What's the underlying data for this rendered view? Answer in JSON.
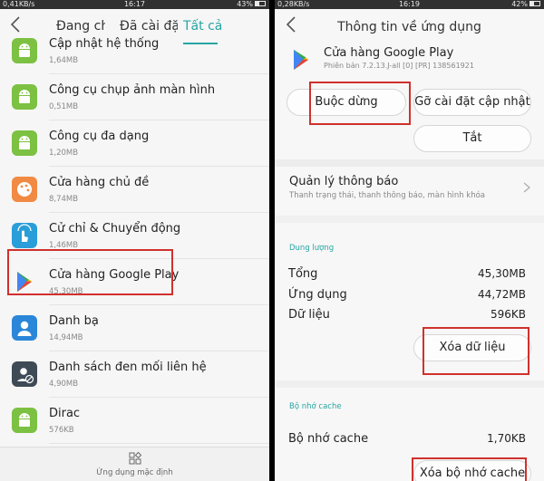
{
  "left": {
    "status": {
      "left": "0,41KB/s",
      "time": "16:17",
      "battery": "43%",
      "battery_level": 0.43
    },
    "tabs": [
      {
        "label": "Đang chạy",
        "active": false
      },
      {
        "label": "Đã cài đặt",
        "active": false
      },
      {
        "label": "Tất cả",
        "active": true
      }
    ],
    "apps": [
      {
        "name": "Cập nhật hệ thống",
        "size": "1,64MB",
        "icon": "android-icon",
        "color": "#7cc142"
      },
      {
        "name": "Công cụ chụp ảnh màn hình",
        "size": "0,51MB",
        "icon": "android-icon",
        "color": "#7cc142"
      },
      {
        "name": "Công cụ đa dạng",
        "size": "1,20MB",
        "icon": "android-icon",
        "color": "#7cc142"
      },
      {
        "name": "Cửa hàng chủ đề",
        "size": "8,74MB",
        "icon": "palette-icon",
        "color": "#f18a43"
      },
      {
        "name": "Cử chỉ & Chuyển động",
        "size": "1,46MB",
        "icon": "gesture-icon",
        "color": "#2a9ed8"
      },
      {
        "name": "Cửa hàng Google Play",
        "size": "45,30MB",
        "icon": "google-play-icon",
        "color": "#ffffff"
      },
      {
        "name": "Danh bạ",
        "size": "14,94MB",
        "icon": "contacts-icon",
        "color": "#2a86d8"
      },
      {
        "name": "Danh sách đen mối liên hệ",
        "size": "4,90MB",
        "icon": "blacklist-icon",
        "color": "#3e4a55"
      },
      {
        "name": "Dirac",
        "size": "576KB",
        "icon": "android-icon",
        "color": "#7cc142"
      }
    ],
    "bottom_label": "Ứng dụng mặc định"
  },
  "right": {
    "status": {
      "left": "0,28KB/s",
      "time": "16:19",
      "battery": "42%",
      "battery_level": 0.42
    },
    "title": "Thông tin về ứng dụng",
    "app_name": "Cửa hàng Google Play",
    "app_version": "Phiên bản 7.2.13.J-all [0] [PR] 138561921",
    "buttons": {
      "force_stop": "Buộc dừng",
      "uninstall_updates": "Gỡ cài đặt cập nhật",
      "disable": "Tắt",
      "clear_data": "Xóa dữ liệu",
      "clear_cache": "Xóa bộ nhớ cache"
    },
    "notifications": {
      "title": "Quản lý thông báo",
      "subtitle": "Thanh trạng thái, thanh thông báo, màn hình khóa"
    },
    "storage": {
      "header": "Dung lượng",
      "rows": [
        {
          "label": "Tổng",
          "value": "45,30MB"
        },
        {
          "label": "Ứng dụng",
          "value": "44,72MB"
        },
        {
          "label": "Dữ liệu",
          "value": "596KB"
        }
      ]
    },
    "cache": {
      "header": "Bộ nhớ cache",
      "label": "Bộ nhớ cache",
      "value": "1,70KB"
    }
  },
  "colors": {
    "accent": "#27a5a3",
    "highlight": "#d0312d"
  }
}
